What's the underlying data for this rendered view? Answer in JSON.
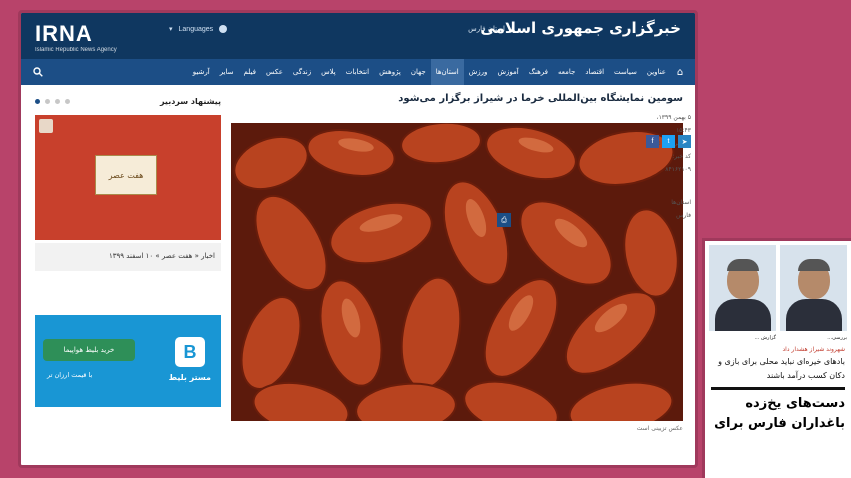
{
  "header": {
    "logo": "IRNA",
    "logo_sub": "Islamic Republic News Agency",
    "languages_label": "Languages",
    "site_title": "خبرگزاری جمهوری اسلامی",
    "province": "استان فارس"
  },
  "nav": {
    "items": [
      "عناوین",
      "سیاست",
      "اقتصاد",
      "جامعه",
      "فرهنگ",
      "آموزش",
      "ورزش",
      "استان‌ها",
      "جهان",
      "پژوهش",
      "انتخابات",
      "پلاس",
      "زندگی",
      "عکس",
      "فیلم",
      "سایر",
      "آرشیو"
    ],
    "active_index": 7
  },
  "sidebar": {
    "suggest_title": "پیشنهاد سردبیر",
    "promo_card": "هفت عصر",
    "promo_caption": "اخبار « هفت عصر » ۱۰ اسفند ۱۳۹۹",
    "ad_button": "خرید بلیط هواپیما",
    "ad_sub": "با قیمت ارزان تر",
    "ad_brand": "مستر بلیط",
    "ad_logo": "B"
  },
  "article": {
    "headline": "سومین نمایشگاه بین‌المللی خرما در شیراز برگزار می‌شود",
    "credit": "عکس تزیینی است"
  },
  "meta": {
    "date": "۵ بهمن ۱۳۹۹، ۱۵:۴۳",
    "id_label": "کد خبرنگار: ۲۱۷۵",
    "news_id": "کد خبر: ۸۴۱۶۲۱۰۹",
    "tag1": "استان‌ها",
    "tag2": "فارس"
  },
  "share": {
    "fb": "f",
    "tw": "t",
    "tg": "➤",
    "print": "⎙"
  },
  "overlay": {
    "cap1": "بررسی...",
    "cap2": "گزارش ...",
    "line": "شهروند شیراز هشدار داد",
    "text1": "بادهای خیره‌ای نباید محلی برای بازی و دکان کسب درآمد باشند",
    "big": "دست‌های یخ‌زده باغداران فارس برای"
  }
}
